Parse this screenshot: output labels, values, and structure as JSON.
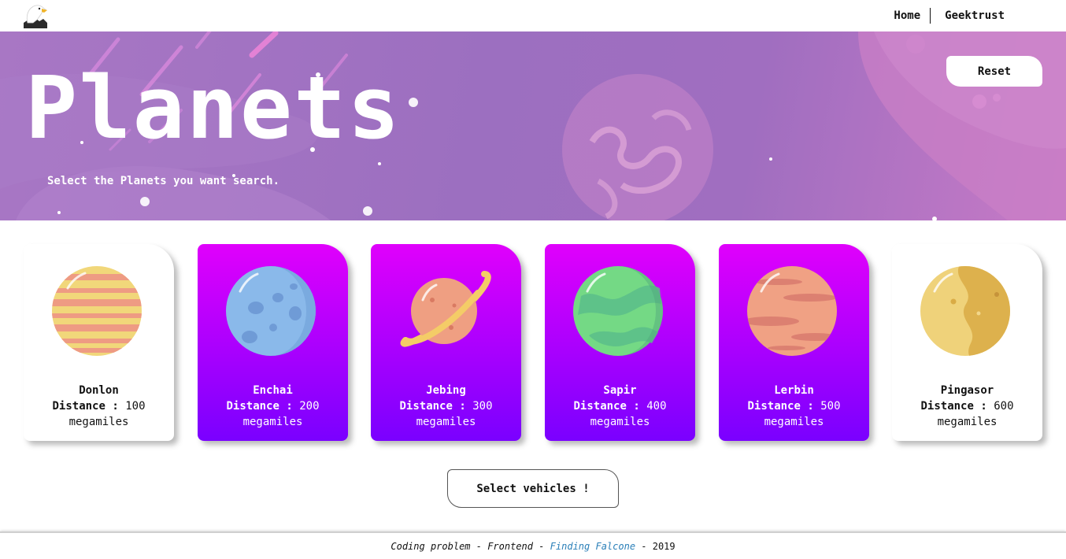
{
  "nav": {
    "logo_icon": "eagle-icon",
    "links": [
      "Home",
      "Geektrust"
    ]
  },
  "hero": {
    "title": "Planets",
    "subtitle": "Select the Planets you want search.",
    "reset_label": "Reset",
    "background_colors": [
      "#a877c4",
      "#9c6fc0",
      "#c77ac6"
    ]
  },
  "planets": [
    {
      "name": "Donlon",
      "distance_label": "Distance :",
      "distance": "100",
      "unit": "megamiles",
      "selected": false,
      "icon": "striped-planet-icon"
    },
    {
      "name": "Enchai",
      "distance_label": "Distance :",
      "distance": "200",
      "unit": "megamiles",
      "selected": true,
      "icon": "blue-cratered-planet-icon"
    },
    {
      "name": "Jebing",
      "distance_label": "Distance :",
      "distance": "300",
      "unit": "megamiles",
      "selected": true,
      "icon": "ringed-planet-icon"
    },
    {
      "name": "Sapir",
      "distance_label": "Distance :",
      "distance": "400",
      "unit": "megamiles",
      "selected": true,
      "icon": "green-planet-icon"
    },
    {
      "name": "Lerbin",
      "distance_label": "Distance :",
      "distance": "500",
      "unit": "megamiles",
      "selected": true,
      "icon": "red-banded-planet-icon"
    },
    {
      "name": "Pingasor",
      "distance_label": "Distance :",
      "distance": "600",
      "unit": "megamiles",
      "selected": false,
      "icon": "yellow-planet-icon"
    }
  ],
  "cta": {
    "label": "Select vehicles !"
  },
  "footer": {
    "prefix": "Coding problem - Frontend - ",
    "link": "Finding Falcone",
    "suffix": " - 2019"
  },
  "colors": {
    "selected_gradient_top": "#e000fc",
    "selected_gradient_bottom": "#7a00ff",
    "footer_link": "#2a7fb8"
  }
}
